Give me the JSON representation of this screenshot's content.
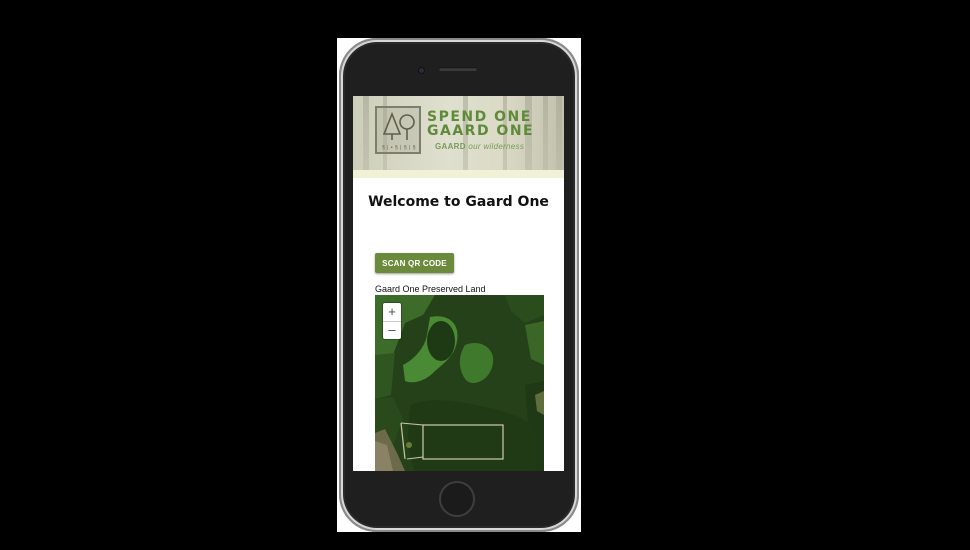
{
  "banner": {
    "logo_small_text": "§ | • § | § | §",
    "slogan_line1": "SPEND ONE",
    "slogan_line2": "GAARD ONE",
    "tagline_brand": "GAARD",
    "tagline_rest": " our wilderness"
  },
  "page": {
    "title": "Welcome to Gaard One"
  },
  "actions": {
    "scan_label": "SCAN QR CODE"
  },
  "map": {
    "label": "Gaard One Preserved Land",
    "zoom_in": "+",
    "zoom_out": "–"
  },
  "colors": {
    "accent": "#6b8a3b",
    "slogan": "#5f8a3a",
    "band": "#f0f1d6"
  }
}
